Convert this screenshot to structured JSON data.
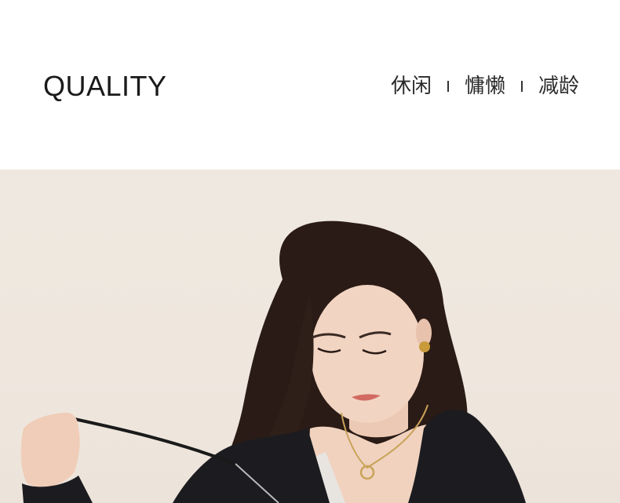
{
  "header": {
    "title": "QUALITY",
    "tags": [
      "休闲",
      "慵懒",
      "减龄"
    ]
  },
  "photo": {
    "subject": "woman-with-long-dark-wavy-hair-in-black-zip-jacket-holding-drawstring",
    "background_color": "#efe8e0"
  }
}
